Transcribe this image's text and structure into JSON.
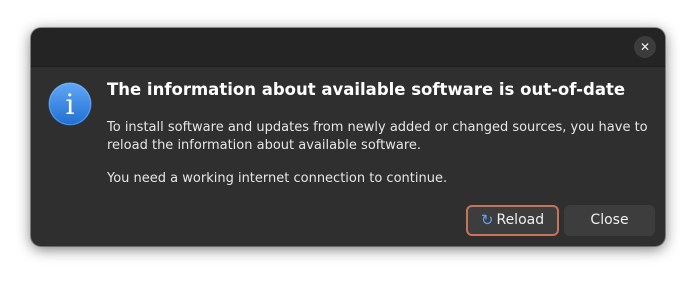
{
  "dialog": {
    "close_glyph": "✕",
    "icon": "info-icon",
    "icon_letter": "i",
    "title": "The information about available software is out-of-date",
    "message_line1": "To install software and updates from newly added or changed sources, you have to reload the information about available software.",
    "message_line2": "You need a working internet connection to continue."
  },
  "buttons": {
    "reload_label": "Reload",
    "reload_icon": "reload-icon",
    "reload_glyph": "↻",
    "close_label": "Close"
  },
  "colors": {
    "dialog_bg": "#2f2f2f",
    "titlebar_bg": "#242424",
    "accent_blue": "#3584e4",
    "reload_outline": "#c7735a"
  }
}
